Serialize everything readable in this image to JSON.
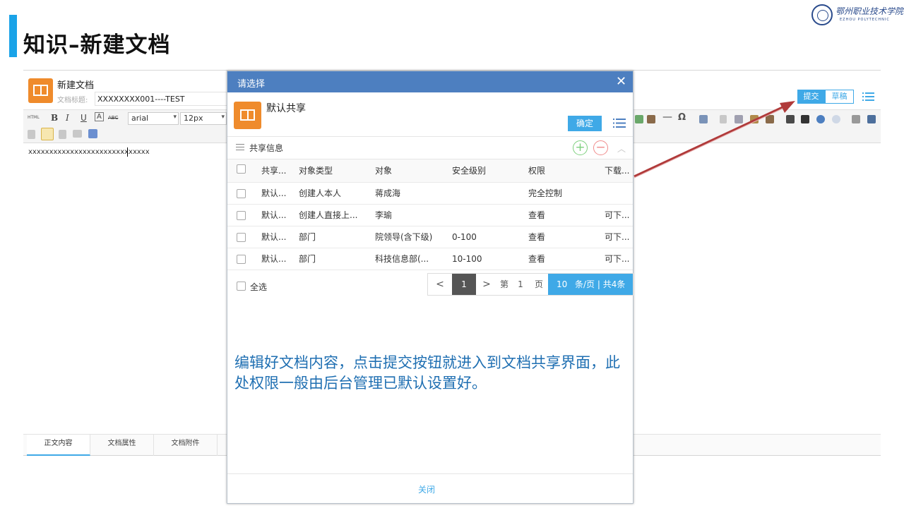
{
  "slide": {
    "title": "知识–新建文档",
    "logo_cn": "鄂州职业技术学院",
    "logo_en": "EZHOU POLYTECHNIC"
  },
  "editor": {
    "heading": "新建文档",
    "title_label": "文档标题:",
    "title_value": "XXXXXXXX001----TEST",
    "submit_label": "提交",
    "draft_label": "草稿",
    "toolbar": {
      "html": "HTML",
      "bold": "B",
      "italic": "I",
      "underline": "U",
      "font_color": "A",
      "strike": "ABC",
      "font_family": "arial",
      "font_size": "12px",
      "hr": "—",
      "omega": "Ω"
    },
    "content": "xxxxxxxxxxxxxxxxxxxxxxxxxxxxx",
    "tabs": [
      "正文内容",
      "文档属性",
      "文档附件"
    ]
  },
  "modal": {
    "title": "请选择",
    "share_title": "默认共享",
    "confirm_label": "确定",
    "section_title": "共享信息",
    "columns": [
      "共享...",
      "对象类型",
      "对象",
      "安全级别",
      "权限",
      "下载..."
    ],
    "rows": [
      [
        "默认...",
        "创建人本人",
        "蒋成海",
        "",
        "完全控制",
        ""
      ],
      [
        "默认...",
        "创建人直接上...",
        "李瑜",
        "",
        "查看",
        "可下..."
      ],
      [
        "默认...",
        "部门",
        "院领导(含下级)",
        "0-100",
        "查看",
        "可下..."
      ],
      [
        "默认...",
        "部门",
        "科技信息部(...",
        "10-100",
        "查看",
        "可下..."
      ]
    ],
    "select_all_label": "全选",
    "pager": {
      "prev": "<",
      "current": "1",
      "next": ">",
      "di": "第",
      "page_number": "1",
      "ye": "页",
      "page_size": "10",
      "size_text": "条/页 | 共4条"
    },
    "annotation": "编辑好文档内容，点击提交按钮就进入到文档共享界面，此处权限一般由后台管理已默认设置好。",
    "close_label": "关闭"
  },
  "colors": {
    "accent": "#1aa3e8",
    "modal_header": "#4d7fc0",
    "button": "#3fa9e7",
    "icon_orange": "#ef8b2c",
    "annotation": "#1f6fb2",
    "arrow": "#b03a3a"
  }
}
